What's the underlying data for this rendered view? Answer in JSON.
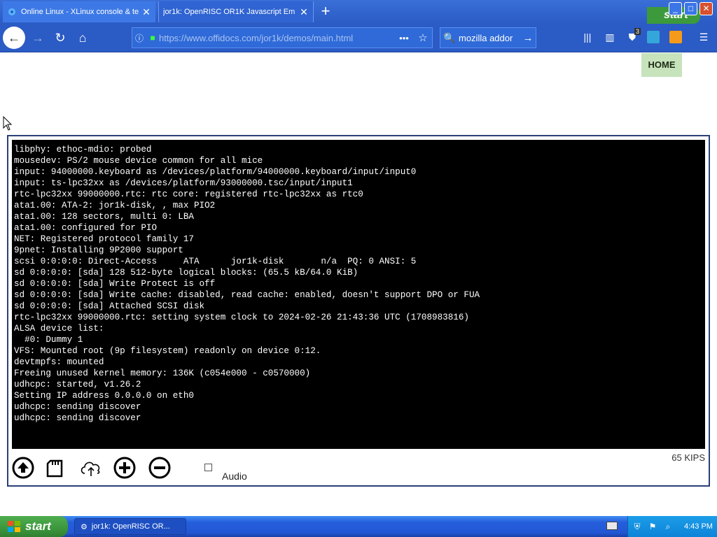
{
  "browser": {
    "tabs": [
      {
        "title": "Online Linux - XLinux console & te",
        "active": false
      },
      {
        "title": "jor1k: OpenRISC OR1K Javascript Em",
        "active": true
      }
    ],
    "new_tab_symbol": "+",
    "url": "https://www.offidocs.com/jor1k/demos/main.html",
    "search_text": "mozilla addor",
    "toolbar_icons": [
      "back-icon",
      "forward-icon",
      "reload-icon",
      "home-icon",
      "info-icon",
      "lock-icon",
      "page-actions-icon",
      "bookmark-star-icon",
      "search-icon",
      "arrow-right-icon",
      "library-icon",
      "sidebar-icon",
      "ublock-icon",
      "extension-icon",
      "extension-icon",
      "menu-icon"
    ],
    "ublock_badge": "3",
    "window_start_label": "start"
  },
  "page": {
    "home_label": "HOME"
  },
  "terminal": {
    "lines": [
      "libphy: ethoc-mdio: probed",
      "mousedev: PS/2 mouse device common for all mice",
      "input: 94000000.keyboard as /devices/platform/94000000.keyboard/input/input0",
      "input: ts-lpc32xx as /devices/platform/93000000.tsc/input/input1",
      "rtc-lpc32xx 99000000.rtc: rtc core: registered rtc-lpc32xx as rtc0",
      "ata1.00: ATA-2: jor1k-disk, , max PIO2",
      "ata1.00: 128 sectors, multi 0: LBA",
      "ata1.00: configured for PIO",
      "NET: Registered protocol family 17",
      "9pnet: Installing 9P2000 support",
      "scsi 0:0:0:0: Direct-Access     ATA      jor1k-disk       n/a  PQ: 0 ANSI: 5",
      "sd 0:0:0:0: [sda] 128 512-byte logical blocks: (65.5 kB/64.0 KiB)",
      "sd 0:0:0:0: [sda] Write Protect is off",
      "sd 0:0:0:0: [sda] Write cache: disabled, read cache: enabled, doesn't support DPO or FUA",
      "sd 0:0:0:0: [sda] Attached SCSI disk",
      "rtc-lpc32xx 99000000.rtc: setting system clock to 2024-02-26 21:43:36 UTC (1708983816)",
      "ALSA device list:",
      "  #0: Dummy 1",
      "VFS: Mounted root (9p filesystem) readonly on device 0:12.",
      "devtmpfs: mounted",
      "Freeing unused kernel memory: 136K (c054e000 - c0570000)",
      "udhcpc: started, v1.26.2",
      "Setting IP address 0.0.0.0 on eth0",
      "udhcpc: sending discover",
      "udhcpc: sending discover"
    ]
  },
  "controls": {
    "audio_label": "Audio",
    "audio_checked": false,
    "speed": "65 KIPS",
    "buttons": [
      "upload-icon",
      "save-icon",
      "cloud-upload-icon",
      "zoom-in-icon",
      "zoom-out-icon"
    ]
  },
  "taskbar": {
    "start_label": "start",
    "task_title": "jor1k: OpenRISC OR...",
    "clock": "4:43 PM"
  },
  "colors": {
    "titlebar": "#2b5bc4",
    "terminal_bg": "#000000",
    "terminal_fg": "#ffffff",
    "home_bg": "#c7e3bc",
    "frame_border": "#2a3f78",
    "taskbar": "#245edb",
    "start_green": "#3c963c"
  }
}
